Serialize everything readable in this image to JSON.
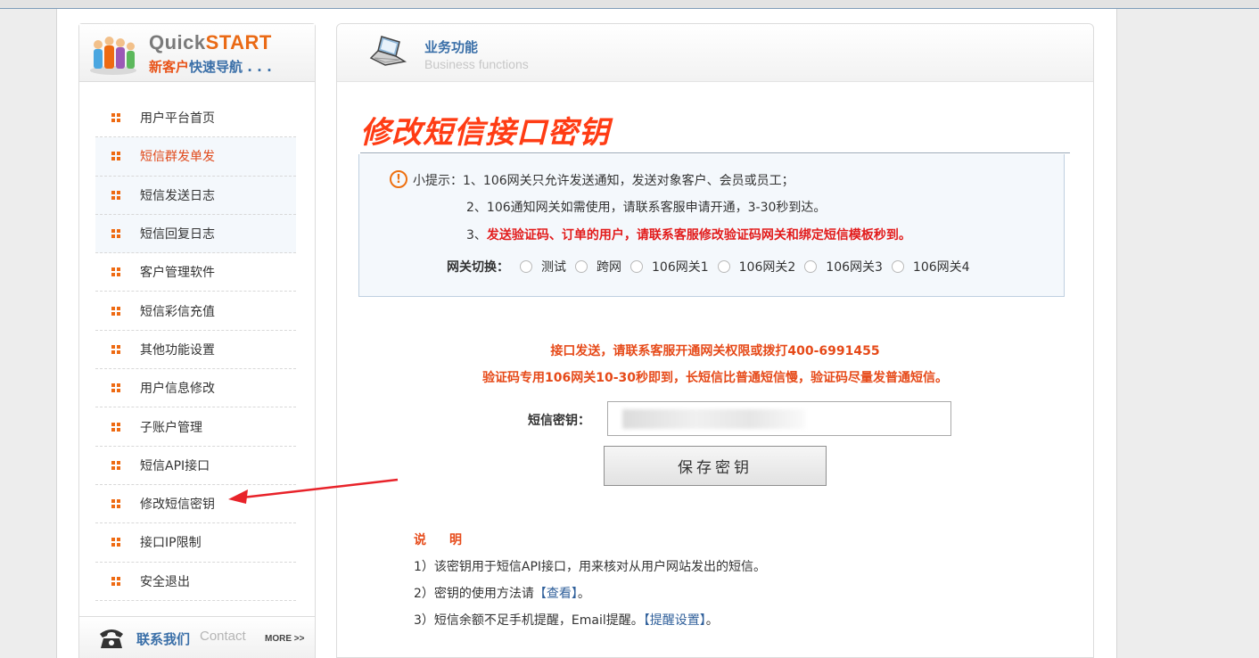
{
  "sidebar": {
    "brand_quick": "Quick",
    "brand_start": "START",
    "subtitle_new": "新客户",
    "subtitle_guide": "快速导航 . . .",
    "items": [
      {
        "label": "用户平台首页"
      },
      {
        "label": "短信群发单发"
      },
      {
        "label": "短信发送日志"
      },
      {
        "label": "短信回复日志"
      },
      {
        "label": "客户管理软件"
      },
      {
        "label": "短信彩信充值"
      },
      {
        "label": "其他功能设置"
      },
      {
        "label": "用户信息修改"
      },
      {
        "label": "子账户管理"
      },
      {
        "label": "短信API接口"
      },
      {
        "label": "修改短信密钥"
      },
      {
        "label": "接口IP限制"
      },
      {
        "label": "安全退出"
      }
    ],
    "contact": {
      "cn": "联系我们",
      "en": "Contact",
      "more": "MORE >>"
    }
  },
  "main": {
    "header_cn": "业务功能",
    "header_en": "Business functions",
    "page_title": "修改短信接口密钥",
    "notice": {
      "line1": "小提示：1、106网关只允许发送通知，发送对象客户、会员或员工；",
      "line2": "2、106通知网关如需使用，请联系客服申请开通，3-30秒到达。",
      "line3_prefix": "3、",
      "line3_red": "发送验证码、订单的用户，请联系客服修改验证码网关和绑定短信模板秒到。"
    },
    "gateway": {
      "label": "网关切换：",
      "options": [
        "测试",
        "跨网",
        "106网关1",
        "106网关2",
        "106网关3",
        "106网关4"
      ]
    },
    "info_line1": "接口发送，请联系客服开通网关权限或拨打400-6991455",
    "info_line2": "验证码专用106网关10-30秒即到，长短信比普通短信慢，验证码尽量发普通短信。",
    "key_label": "短信密钥：",
    "key_value": "",
    "save_label": "保存密钥",
    "notes_title": "说　明",
    "note1": "1）该密钥用于短信API接口，用来核对从用户网站发出的短信。",
    "note2_prefix": "2）密钥的使用方法请",
    "note2_link": "【查看】",
    "note2_suffix": "。",
    "note3_prefix": "3）短信余额不足手机提醒，Email提醒。",
    "note3_link": "【提醒设置】",
    "note3_suffix": "。"
  },
  "colors": {
    "accent_orange": "#ee6a12",
    "title_red": "#ff3c14",
    "link_blue": "#2f5f9a",
    "alert_red": "#e21b1b"
  }
}
